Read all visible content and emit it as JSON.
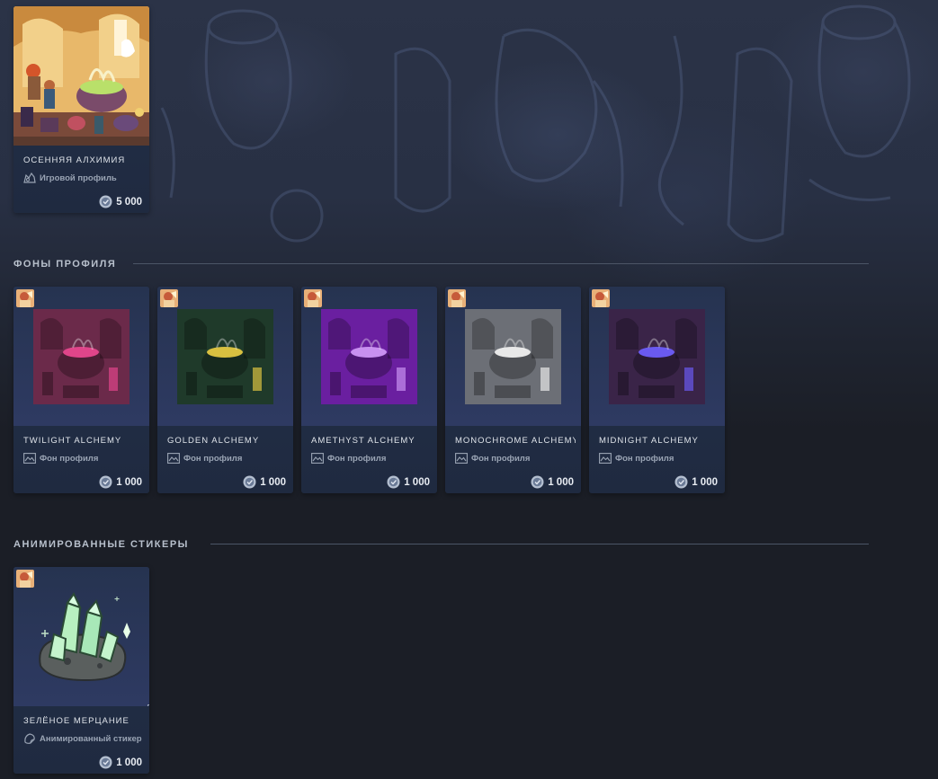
{
  "featured": {
    "name": "ОСЕННЯЯ АЛХИМИЯ",
    "type_label": "Игровой профиль",
    "type_icon": "profile-icon",
    "price": "5 000",
    "price_icon": "points-coin-icon"
  },
  "backgrounds": {
    "title": "ФОНЫ ПРОФИЛЯ",
    "items": [
      {
        "name": "TWILIGHT ALCHEMY",
        "type_label": "Фон профиля",
        "price": "1 000",
        "tint": "#6b2a4a",
        "accent": "#e0458a"
      },
      {
        "name": "GOLDEN ALCHEMY",
        "type_label": "Фон профиля",
        "price": "1 000",
        "tint": "#1f3a2a",
        "accent": "#d8c040"
      },
      {
        "name": "AMETHYST ALCHEMY",
        "type_label": "Фон профиля",
        "price": "1 000",
        "tint": "#6a1fa0",
        "accent": "#c890f0"
      },
      {
        "name": "MONOCHROME ALCHEMY",
        "type_label": "Фон профиля",
        "price": "1 000",
        "tint": "#6c6f76",
        "accent": "#e8e8e8"
      },
      {
        "name": "MIDNIGHT ALCHEMY",
        "type_label": "Фон профиля",
        "price": "1 000",
        "tint": "#3a2448",
        "accent": "#6a5af0"
      }
    ]
  },
  "stickers": {
    "title": "АНИМИРОВАННЫЕ СТИКЕРЫ",
    "items": [
      {
        "name": "ЗЕЛЁНОЕ МЕРЦАНИЕ",
        "type_label": "Анимированный стикер",
        "price": "1 000"
      }
    ]
  },
  "colors": {
    "card_bg": "#1f2a40",
    "accent_text": "#dfe4ea",
    "muted_text": "#9aa4b4"
  }
}
